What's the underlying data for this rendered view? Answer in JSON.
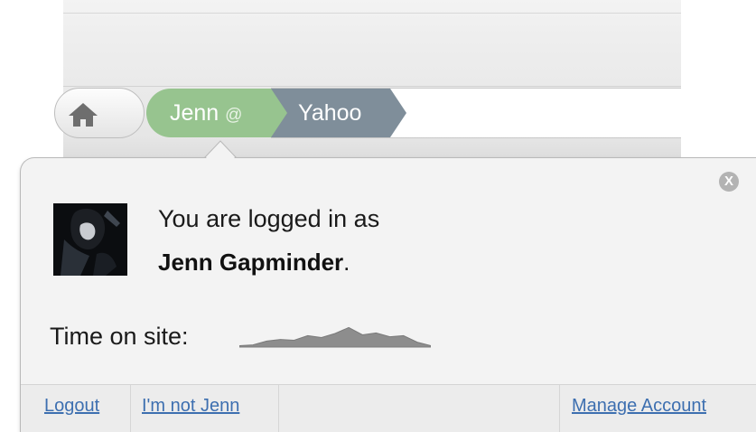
{
  "address_bar": {
    "home_icon": "home-icon",
    "user_crumb": "Jenn",
    "user_at": "@",
    "site_crumb": "Yahoo"
  },
  "popover": {
    "close_icon": "close-icon",
    "close_glyph": "X",
    "login_prefix": "You are logged in as",
    "login_name": "Jenn Gapminder",
    "login_suffix": ".",
    "time_label": "Time on site:",
    "time_sparkline": [
      0.05,
      0.08,
      0.22,
      0.28,
      0.25,
      0.42,
      0.35,
      0.5,
      0.72,
      0.45,
      0.52,
      0.38,
      0.42,
      0.18,
      0.05
    ],
    "links": {
      "logout": "Logout",
      "not_user": "I'm not Jenn",
      "manage_account": "Manage Account"
    }
  },
  "colors": {
    "user_crumb": "#97c48f",
    "site_crumb": "#7f8e9a",
    "link": "#3d6fb0",
    "sparkline": "#8d8d8d"
  }
}
